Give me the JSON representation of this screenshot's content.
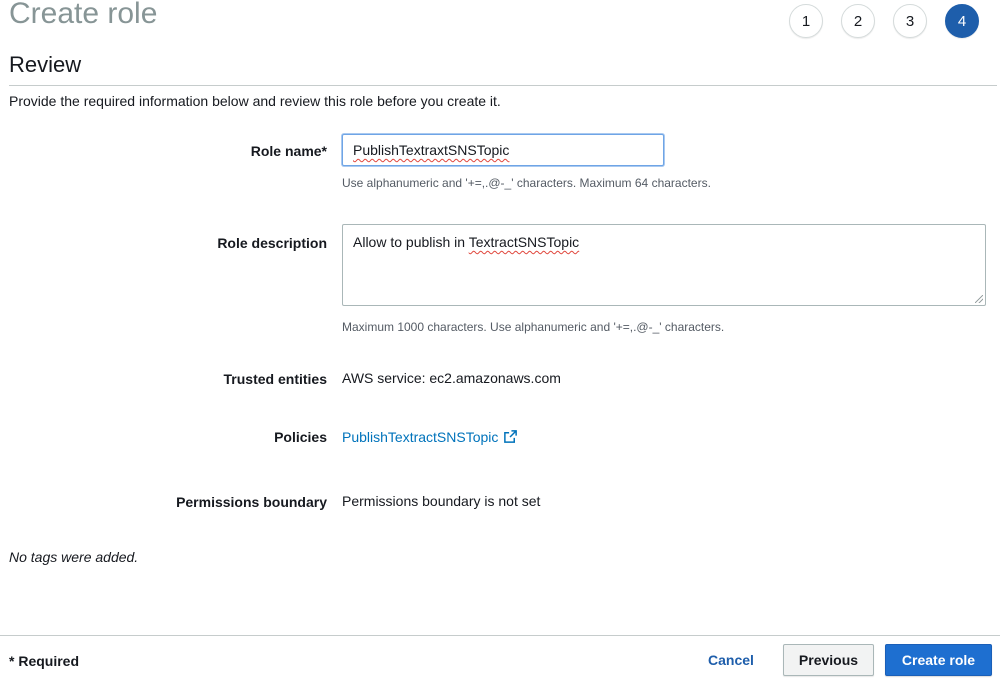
{
  "page_title": "Create role",
  "steps": [
    "1",
    "2",
    "3",
    "4"
  ],
  "active_step": "4",
  "section_title": "Review",
  "intro": "Provide the required information below and review this role before you create it.",
  "role_name": {
    "label": "Role name*",
    "value": "PublishTextraxtSNSTopic",
    "hint": "Use alphanumeric and '+=,.@-_' characters. Maximum 64 characters."
  },
  "role_description": {
    "label": "Role description",
    "value_prefix": "Allow to publish in ",
    "value_misspelled": "TextractSNSTopic",
    "hint": "Maximum 1000 characters. Use alphanumeric and '+=,.@-_' characters."
  },
  "trusted_entities": {
    "label": "Trusted entities",
    "value": "AWS service: ec2.amazonaws.com"
  },
  "policies": {
    "label": "Policies",
    "link": "PublishTextractSNSTopic",
    "icon": "external-link-icon"
  },
  "permissions_boundary": {
    "label": "Permissions boundary",
    "value": "Permissions boundary is not set"
  },
  "no_tags": "No tags were added.",
  "footer": {
    "required_note": "* Required",
    "cancel_label": "Cancel",
    "previous_label": "Previous",
    "create_label": "Create role"
  },
  "colors": {
    "primary": "#1e6fd0",
    "link": "#0073bb",
    "active_step": "#1e5eab",
    "title_gray": "#879596"
  }
}
